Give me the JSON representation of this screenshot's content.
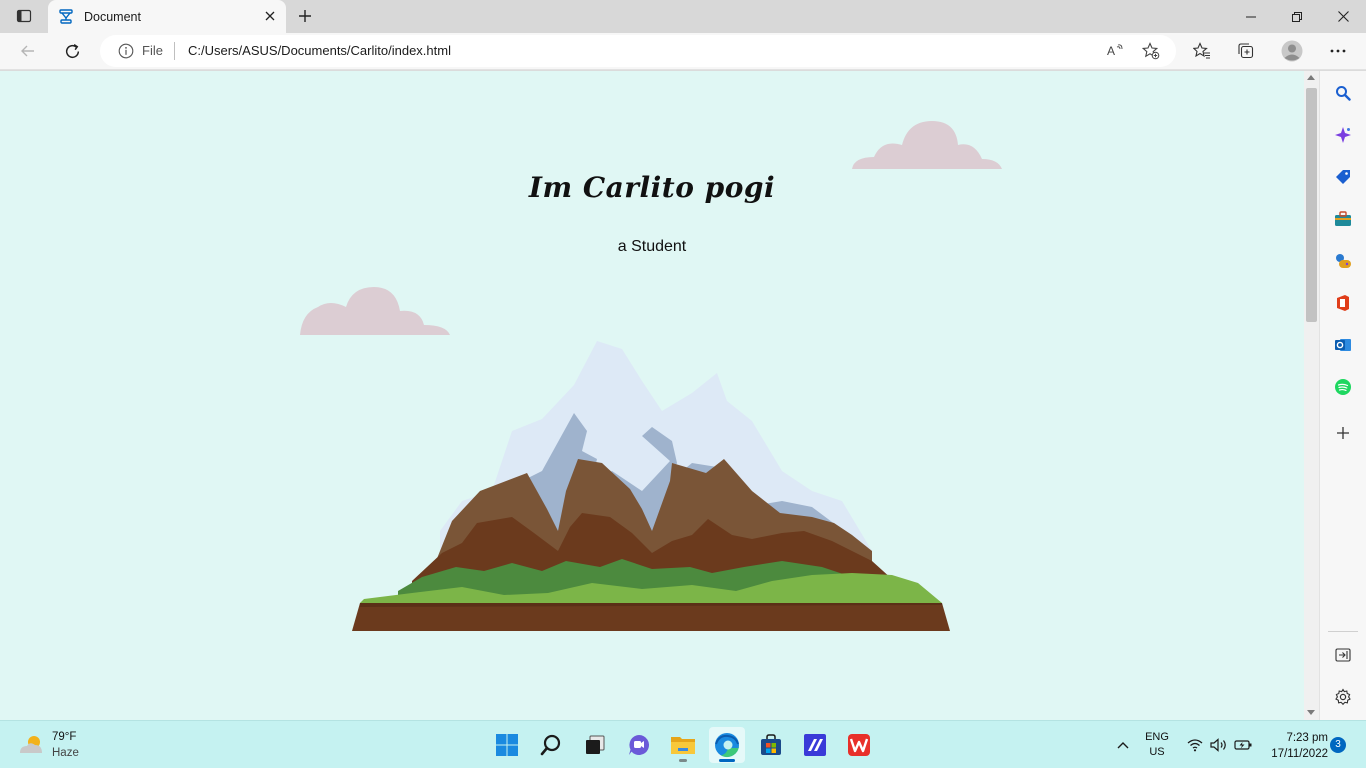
{
  "tab": {
    "title": "Document",
    "favicon": "document-tab-icon"
  },
  "address_bar": {
    "protocol_label": "File",
    "url": "C:/Users/ASUS/Documents/Carlito/index.html"
  },
  "page": {
    "heading": "Im Carlito pogi",
    "subheading": "a Student",
    "background_color": "#e0f7f4",
    "cloud_color": "#dccdd3"
  },
  "sidebar": {
    "items": [
      "search-icon",
      "copilot-icon",
      "shopping-tag-icon",
      "tools-icon",
      "games-icon",
      "office-icon",
      "outlook-icon",
      "spotify-icon",
      "add-icon"
    ],
    "bottom_items": [
      "hide-sidebar-icon",
      "settings-icon"
    ]
  },
  "taskbar": {
    "weather": {
      "temp": "79°F",
      "condition": "Haze"
    },
    "apps": [
      "start-icon",
      "search-icon",
      "task-view-icon",
      "teams-chat-icon",
      "file-explorer-icon",
      "edge-icon",
      "store-icon",
      "visual-studio-icon",
      "wps-office-icon"
    ],
    "language": {
      "line1": "ENG",
      "line2": "US"
    },
    "time": "7:23 pm",
    "date": "17/11/2022",
    "notifications": "3"
  }
}
